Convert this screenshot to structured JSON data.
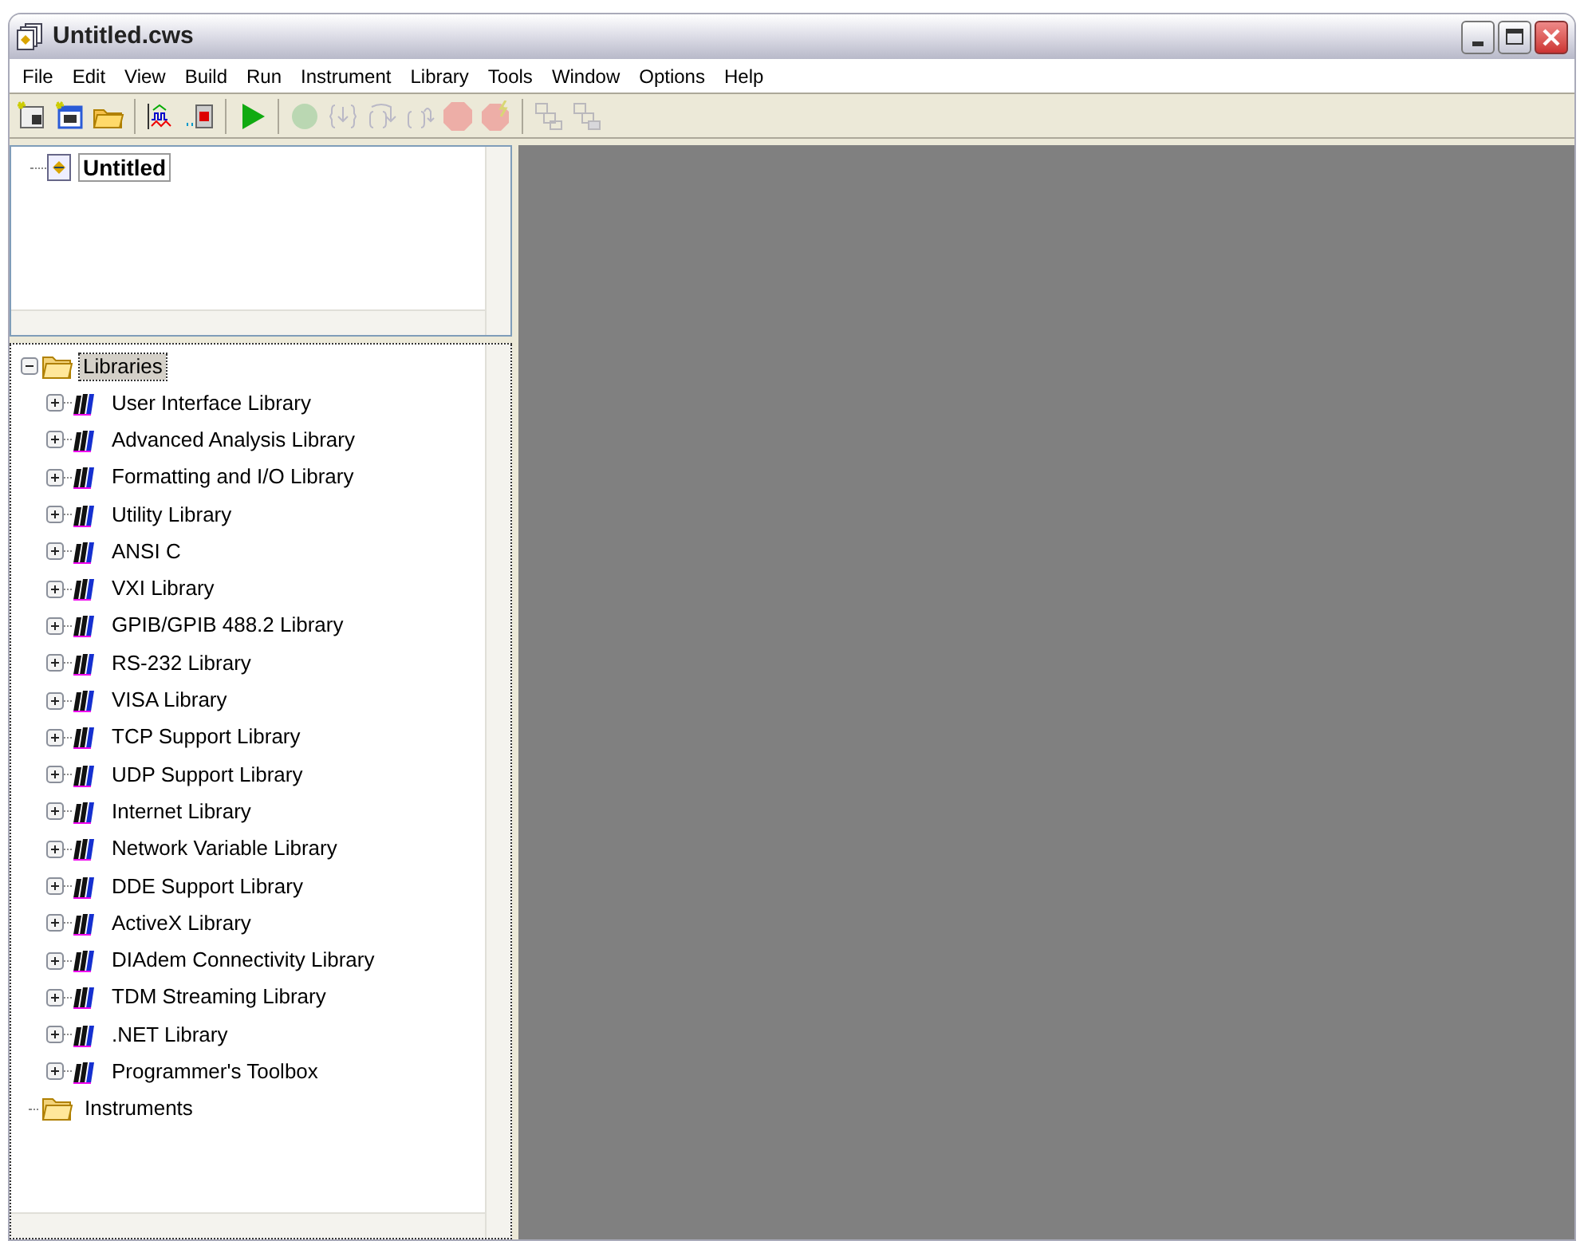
{
  "window": {
    "title": "Untitled.cws"
  },
  "menu": [
    "File",
    "Edit",
    "View",
    "Build",
    "Run",
    "Instrument",
    "Library",
    "Tools",
    "Window",
    "Options",
    "Help"
  ],
  "toolbar": [
    {
      "kind": "new-source",
      "disabled": false
    },
    {
      "kind": "new-uir",
      "disabled": false
    },
    {
      "kind": "open",
      "disabled": false
    },
    {
      "kind": "separator"
    },
    {
      "kind": "graph",
      "disabled": false
    },
    {
      "kind": "panel",
      "disabled": false
    },
    {
      "kind": "separator"
    },
    {
      "kind": "run",
      "disabled": false
    },
    {
      "kind": "separator"
    },
    {
      "kind": "go",
      "disabled": true
    },
    {
      "kind": "step-into",
      "disabled": true
    },
    {
      "kind": "step-over",
      "disabled": true
    },
    {
      "kind": "step-out",
      "disabled": true
    },
    {
      "kind": "stop",
      "disabled": true
    },
    {
      "kind": "stop-bolt",
      "disabled": true
    },
    {
      "kind": "separator"
    },
    {
      "kind": "windows-up",
      "disabled": true
    },
    {
      "kind": "windows-down",
      "disabled": true
    }
  ],
  "project_tree": [
    {
      "label": "Untitled",
      "selected": true
    }
  ],
  "library_tree": [
    {
      "label": "Libraries",
      "kind": "folder",
      "expanded": true,
      "selected": true,
      "children": [
        {
          "label": "User Interface Library",
          "kind": "library",
          "expanded": false,
          "selected": false
        },
        {
          "label": "Advanced Analysis Library",
          "kind": "library",
          "expanded": false,
          "selected": false
        },
        {
          "label": "Formatting and I/O Library",
          "kind": "library",
          "expanded": false,
          "selected": false
        },
        {
          "label": "Utility Library",
          "kind": "library",
          "expanded": false,
          "selected": false
        },
        {
          "label": "ANSI C",
          "kind": "library",
          "expanded": false,
          "selected": false
        },
        {
          "label": "VXI Library",
          "kind": "library",
          "expanded": false,
          "selected": false
        },
        {
          "label": "GPIB/GPIB 488.2 Library",
          "kind": "library",
          "expanded": false,
          "selected": false
        },
        {
          "label": "RS-232 Library",
          "kind": "library",
          "expanded": false,
          "selected": false
        },
        {
          "label": "VISA Library",
          "kind": "library",
          "expanded": false,
          "selected": false
        },
        {
          "label": "TCP Support Library",
          "kind": "library",
          "expanded": false,
          "selected": false
        },
        {
          "label": "UDP Support Library",
          "kind": "library",
          "expanded": false,
          "selected": false
        },
        {
          "label": "Internet Library",
          "kind": "library",
          "expanded": false,
          "selected": false
        },
        {
          "label": "Network Variable Library",
          "kind": "library",
          "expanded": false,
          "selected": false
        },
        {
          "label": "DDE Support Library",
          "kind": "library",
          "expanded": false,
          "selected": false
        },
        {
          "label": "ActiveX Library",
          "kind": "library",
          "expanded": false,
          "selected": false
        },
        {
          "label": "DIAdem Connectivity Library",
          "kind": "library",
          "expanded": false,
          "selected": false
        },
        {
          "label": "TDM Streaming Library",
          "kind": "library",
          "expanded": false,
          "selected": false
        },
        {
          "label": ".NET Library",
          "kind": "library",
          "expanded": false,
          "selected": false
        },
        {
          "label": "Programmer's Toolbox",
          "kind": "library",
          "expanded": false,
          "selected": false
        }
      ]
    },
    {
      "label": "Instruments",
      "kind": "folder",
      "selected": false
    }
  ]
}
